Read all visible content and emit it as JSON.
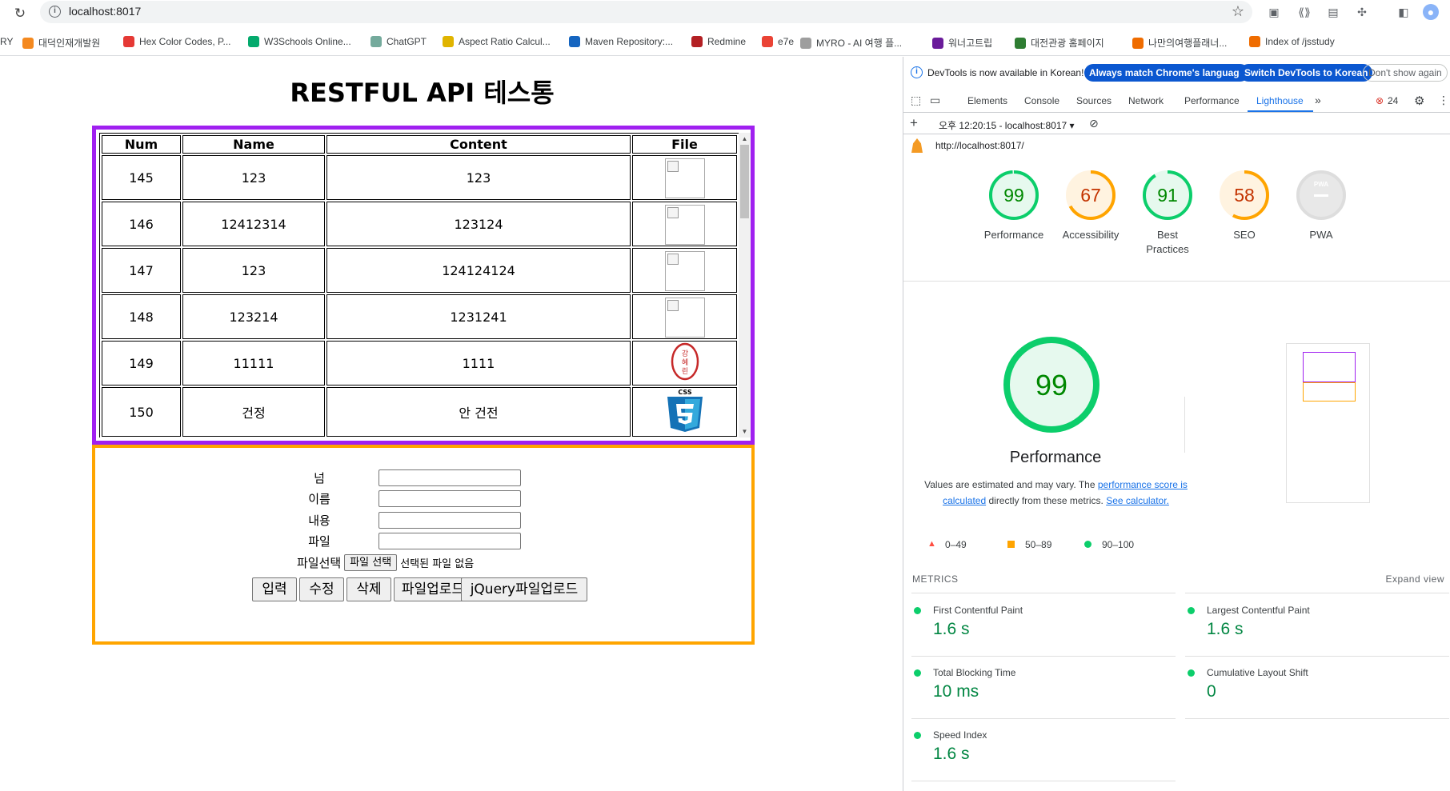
{
  "browser": {
    "url": "localhost:8017",
    "bookmarks": [
      {
        "label": "대덕인재개발원",
        "color": "#f4891f"
      },
      {
        "label": "Hex Color Codes, P...",
        "color": "#e53935"
      },
      {
        "label": "W3Schools Online...",
        "color": "#04aa6d"
      },
      {
        "label": "ChatGPT",
        "color": "#74aa9c"
      },
      {
        "label": "Aspect Ratio Calcul...",
        "color": "#e0b400"
      },
      {
        "label": "Maven Repository:...",
        "color": "#1565c0"
      },
      {
        "label": "Redmine",
        "color": "#b32024"
      },
      {
        "label": "e7e",
        "color": "#ea4335"
      },
      {
        "label": "MYRO - AI 여행 플...",
        "color": "#9e9e9e"
      },
      {
        "label": "워너고트립",
        "color": "#6a1b9a"
      },
      {
        "label": "대전관광 홈페이지",
        "color": "#2e7d32"
      },
      {
        "label": "나만의여행플래너...",
        "color": "#ef6c00"
      },
      {
        "label": "Index of /jsstudy",
        "color": "#ef6c00"
      }
    ]
  },
  "page": {
    "title": "RESTFUL API 테스통",
    "table": {
      "headers": [
        "Num",
        "Name",
        "Content",
        "File"
      ],
      "rows": [
        {
          "num": "145",
          "name": "123",
          "content": "123",
          "file": "broken"
        },
        {
          "num": "146",
          "name": "12412314",
          "content": "123124",
          "file": "broken"
        },
        {
          "num": "147",
          "name": "123",
          "content": "124124124",
          "file": "broken"
        },
        {
          "num": "148",
          "name": "123214",
          "content": "1231241",
          "file": "broken"
        },
        {
          "num": "149",
          "name": "11111",
          "content": "1111",
          "file": "seal"
        },
        {
          "num": "150",
          "name": "건정",
          "content": "안 건전",
          "file": "css3"
        }
      ]
    },
    "seal_text": "강혜린",
    "css_logo_text": "CSS",
    "form": {
      "labels": [
        "넘",
        "이름",
        "내용",
        "파일"
      ],
      "file_label": "파일선택",
      "file_button": "파일 선택",
      "file_none": "선택된 파일 없음",
      "buttons": [
        "입력",
        "수정",
        "삭제",
        "파일업로드",
        "jQuery파일업로드"
      ]
    }
  },
  "devtools": {
    "info_text": "DevTools is now available in Korean!",
    "btn_match": "Always match Chrome's language",
    "btn_switch": "Switch DevTools to Korean",
    "btn_dont": "Don't show again",
    "tabs": [
      "Elements",
      "Console",
      "Sources",
      "Network",
      "Performance",
      "Lighthouse"
    ],
    "error_count": "24",
    "report_time": "오후 12:20:15 - localhost:8017 ▾",
    "report_url": "http://localhost:8017/",
    "scores": [
      {
        "label": "Performance",
        "value": 99,
        "color": "#0cce6b",
        "bg": "#e6f9ee",
        "text": "#008800"
      },
      {
        "label": "Accessibility",
        "value": 67,
        "color": "#ffa400",
        "bg": "#fff3e0",
        "text": "#c33300"
      },
      {
        "label": "Best Practices",
        "value": 91,
        "color": "#0cce6b",
        "bg": "#e6f9ee",
        "text": "#008800"
      },
      {
        "label": "SEO",
        "value": 58,
        "color": "#ffa400",
        "bg": "#fff3e0",
        "text": "#c33300"
      },
      {
        "label": "PWA",
        "value": null,
        "color": "#cccccc",
        "bg": "#e8e8e8",
        "text": "#9e9e9e"
      }
    ],
    "pwa_badge": "PWA",
    "big_score": "99",
    "big_title": "Performance",
    "desc_1": "Values are estimated and may vary. The ",
    "desc_link1": "performance score is calculated",
    "desc_2": " directly from these metrics. ",
    "desc_link2": "See calculator.",
    "legend": [
      "0–49",
      "50–89",
      "90–100"
    ],
    "metrics_title": "METRICS",
    "expand_view": "Expand view",
    "metrics": [
      {
        "name": "First Contentful Paint",
        "value": "1.6 s"
      },
      {
        "name": "Largest Contentful Paint",
        "value": "1.6 s"
      },
      {
        "name": "Total Blocking Time",
        "value": "10 ms"
      },
      {
        "name": "Cumulative Layout Shift",
        "value": "0"
      },
      {
        "name": "Speed Index",
        "value": "1.6 s"
      }
    ]
  }
}
